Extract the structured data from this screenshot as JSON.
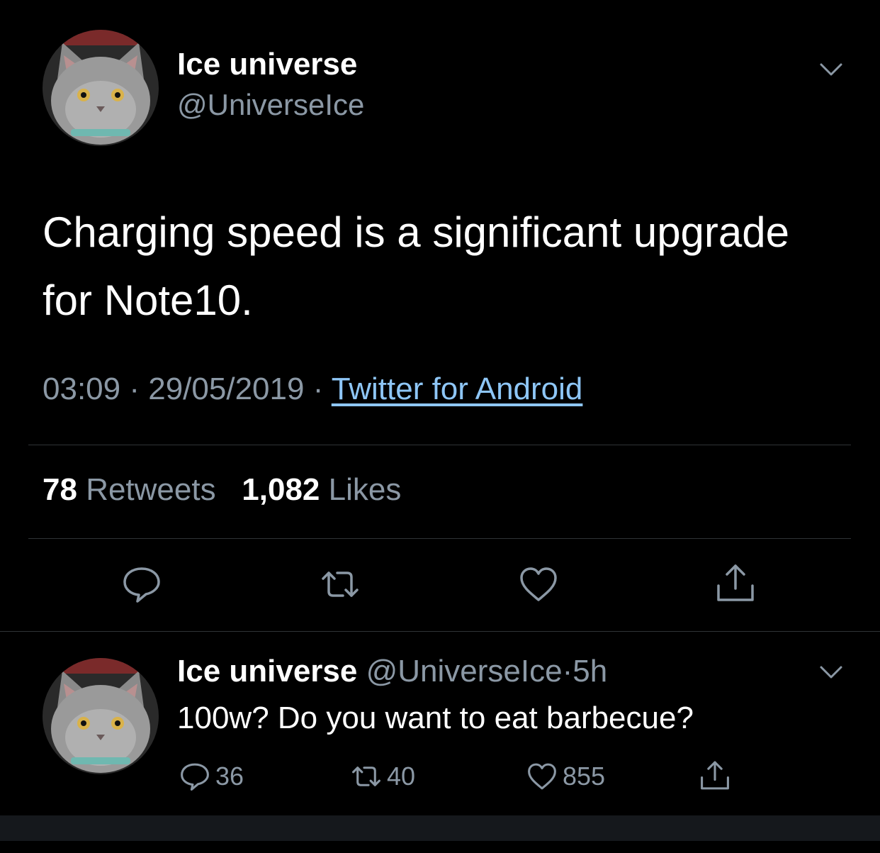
{
  "colors": {
    "background": "#000000",
    "text_primary": "#ffffff",
    "text_secondary": "#8b98a5",
    "link": "#8ec6f6",
    "divider": "#2f3336"
  },
  "tweet": {
    "author": {
      "display_name": "Ice universe",
      "handle": "@UniverseIce",
      "avatar_icon": "cat-avatar-icon"
    },
    "menu_icon": "chevron-down-icon",
    "text": "Charging speed is a significant upgrade for Note10.",
    "time": "03:09",
    "separator": "·",
    "date": "29/05/2019",
    "source": "Twitter for Android",
    "stats": {
      "retweets_count": "78",
      "retweets_label": "Retweets",
      "likes_count": "1,082",
      "likes_label": "Likes"
    },
    "actions": {
      "reply_icon": "reply-icon",
      "retweet_icon": "retweet-icon",
      "like_icon": "heart-icon",
      "share_icon": "share-icon"
    }
  },
  "reply": {
    "author": {
      "display_name": "Ice universe",
      "handle": "@UniverseIce",
      "separator": "·",
      "time_ago": "5h"
    },
    "text": "100w? Do you want to eat barbecue?",
    "counts": {
      "replies": "36",
      "retweets": "40",
      "likes": "855"
    }
  }
}
